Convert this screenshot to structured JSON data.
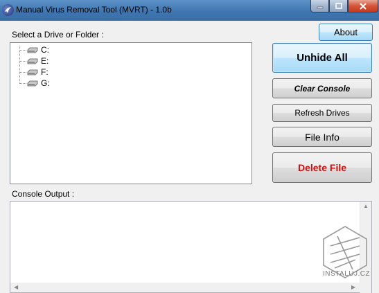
{
  "window": {
    "title": "Manual Virus Removal Tool (MVRT) - 1.0b"
  },
  "labels": {
    "select_drive": "Select a Drive or Folder :",
    "console_output": "Console Output :"
  },
  "tree": {
    "items": [
      {
        "label": "C:",
        "icon": "drive-icon"
      },
      {
        "label": "E:",
        "icon": "drive-icon"
      },
      {
        "label": "F:",
        "icon": "drive-icon"
      },
      {
        "label": "G:",
        "icon": "drive-icon"
      }
    ]
  },
  "buttons": {
    "about": "About",
    "unhide_all": "Unhide All",
    "clear_console": "Clear Console",
    "refresh_drives": "Refresh Drives",
    "file_info": "File Info",
    "delete_file": "Delete File"
  },
  "console": {
    "text": ""
  },
  "watermark": {
    "text": "INSTALUJ.CZ"
  },
  "colors": {
    "delete_text": "#cc1010",
    "titlebar": "#3f76b1",
    "accent_button": "#3c7fb1"
  }
}
